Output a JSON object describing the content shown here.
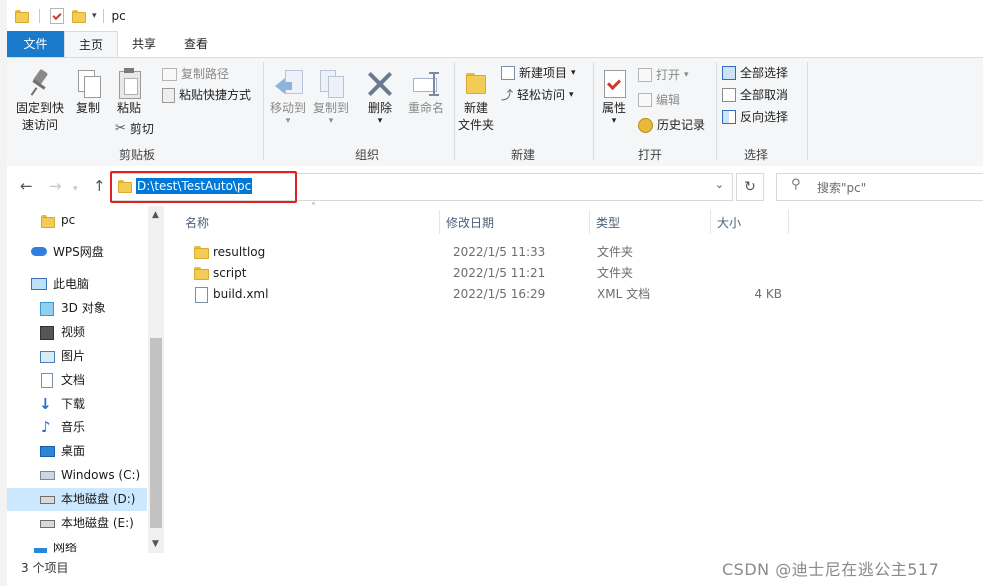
{
  "window": {
    "title": "pc"
  },
  "tabs": {
    "file": "文件",
    "home": "主页",
    "share": "共享",
    "view": "查看"
  },
  "ribbon": {
    "clipboard": {
      "group": "剪贴板",
      "pin_line1": "固定到快",
      "pin_line2": "速访问",
      "copy": "复制",
      "paste": "粘贴",
      "copy_path": "复制路径",
      "paste_shortcut": "粘贴快捷方式",
      "cut": "剪切"
    },
    "organize": {
      "group": "组织",
      "move_to": "移动到",
      "copy_to": "复制到",
      "delete": "删除",
      "rename": "重命名"
    },
    "new": {
      "group": "新建",
      "new_folder_line1": "新建",
      "new_folder_line2": "文件夹",
      "new_item": "新建项目",
      "easy_access": "轻松访问"
    },
    "open": {
      "group": "打开",
      "properties": "属性",
      "open": "打开",
      "edit": "编辑",
      "history": "历史记录"
    },
    "select": {
      "group": "选择",
      "select_all": "全部选择",
      "select_none": "全部取消",
      "invert": "反向选择"
    }
  },
  "address": {
    "path": "D:\\test\\TestAuto\\pc"
  },
  "search": {
    "placeholder": "搜索\"pc\""
  },
  "navpane": {
    "items": [
      {
        "label": "pc"
      },
      {
        "label": "WPS网盘"
      },
      {
        "label": "此电脑"
      },
      {
        "label": "3D 对象"
      },
      {
        "label": "视频"
      },
      {
        "label": "图片"
      },
      {
        "label": "文档"
      },
      {
        "label": "下载"
      },
      {
        "label": "音乐"
      },
      {
        "label": "桌面"
      },
      {
        "label": "Windows (C:)"
      },
      {
        "label": "本地磁盘 (D:)"
      },
      {
        "label": "本地磁盘 (E:)"
      },
      {
        "label": "网络"
      }
    ]
  },
  "columns": {
    "name": "名称",
    "date": "修改日期",
    "type": "类型",
    "size": "大小"
  },
  "files": [
    {
      "name": "resultlog",
      "date": "2022/1/5 11:33",
      "type": "文件夹",
      "size": ""
    },
    {
      "name": "script",
      "date": "2022/1/5 11:21",
      "type": "文件夹",
      "size": ""
    },
    {
      "name": "build.xml",
      "date": "2022/1/5 16:29",
      "type": "XML 文档",
      "size": "4 KB"
    }
  ],
  "status": {
    "count": "3 个项目"
  },
  "watermark": "CSDN @迪士尼在逃公主517",
  "colors": {
    "accent": "#1979ca",
    "selection": "#0078d7",
    "highlight_box": "#e02020",
    "nav_selected": "#cce8ff"
  }
}
